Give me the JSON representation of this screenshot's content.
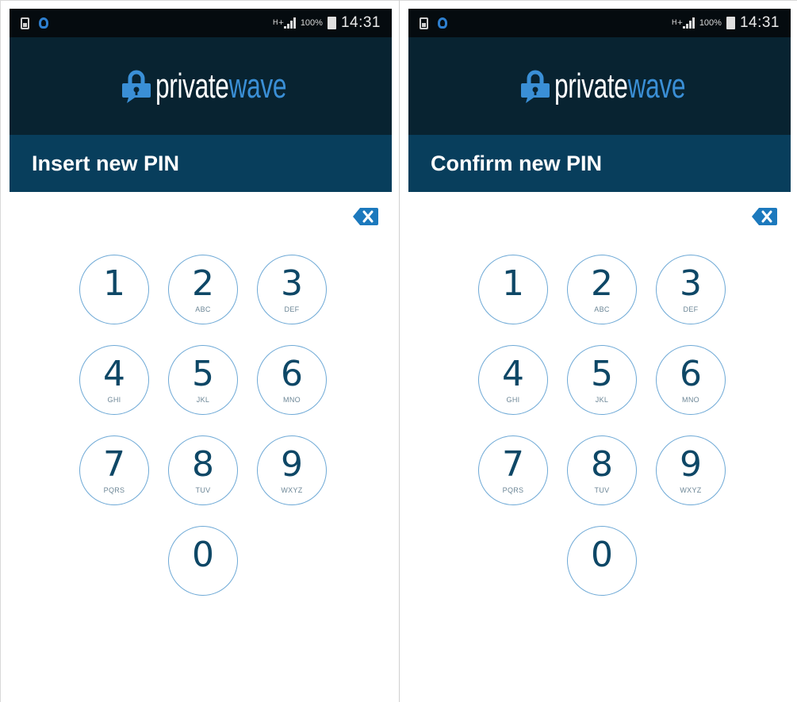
{
  "screens": [
    {
      "status": {
        "network": "H+",
        "battery_pct": "100%",
        "time": "14:31"
      },
      "brand": {
        "word1": "private",
        "word2": "wave"
      },
      "title": "Insert new PIN",
      "keys": [
        {
          "num": "1",
          "sub": ""
        },
        {
          "num": "2",
          "sub": "ABC"
        },
        {
          "num": "3",
          "sub": "DEF"
        },
        {
          "num": "4",
          "sub": "GHI"
        },
        {
          "num": "5",
          "sub": "JKL"
        },
        {
          "num": "6",
          "sub": "MNO"
        },
        {
          "num": "7",
          "sub": "PQRS"
        },
        {
          "num": "8",
          "sub": "TUV"
        },
        {
          "num": "9",
          "sub": "WXYZ"
        },
        {
          "num": "0",
          "sub": ""
        }
      ]
    },
    {
      "status": {
        "network": "H+",
        "battery_pct": "100%",
        "time": "14:31"
      },
      "brand": {
        "word1": "private",
        "word2": "wave"
      },
      "title": "Confirm new PIN",
      "keys": [
        {
          "num": "1",
          "sub": ""
        },
        {
          "num": "2",
          "sub": "ABC"
        },
        {
          "num": "3",
          "sub": "DEF"
        },
        {
          "num": "4",
          "sub": "GHI"
        },
        {
          "num": "5",
          "sub": "JKL"
        },
        {
          "num": "6",
          "sub": "MNO"
        },
        {
          "num": "7",
          "sub": "PQRS"
        },
        {
          "num": "8",
          "sub": "TUV"
        },
        {
          "num": "9",
          "sub": "WXYZ"
        },
        {
          "num": "0",
          "sub": ""
        }
      ]
    }
  ],
  "colors": {
    "statusbar_bg": "#050b0f",
    "brandbar_bg": "#082331",
    "titlebar_bg": "#083e5c",
    "brand_accent": "#3a8fd6",
    "key_border": "#6ea9d6",
    "key_digit": "#0e4766"
  },
  "icons": {
    "status_left": [
      "sim-card-icon",
      "app-notification-icon"
    ],
    "status_right": [
      "signal-strength-icon",
      "battery-icon"
    ],
    "backspace": "backspace-icon",
    "logo": "lock-chat-bubble-icon"
  }
}
